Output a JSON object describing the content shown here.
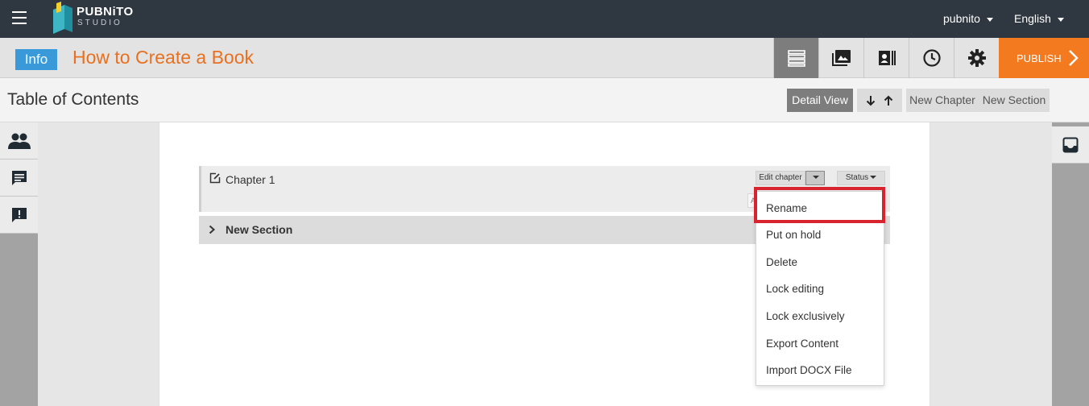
{
  "topbar": {
    "logo_name": "PUBNiTO",
    "logo_sub": "STUDIO",
    "user": "pubnito",
    "language": "English"
  },
  "titlebar": {
    "info": "Info",
    "book_title": "How to Create a Book",
    "publish": "PUBLISH"
  },
  "toolbar": {
    "page_title": "Table of Contents",
    "detail_view": "Detail View",
    "new_chapter": "New Chapter",
    "new_section": "New Section"
  },
  "chapter": {
    "name": "Chapter 1",
    "edit_label": "Edit chapter",
    "status_label": "Status",
    "peek_text": "A"
  },
  "section": {
    "name": "New Section"
  },
  "menu": {
    "items": [
      "Rename",
      "Put on hold",
      "Delete",
      "Lock editing",
      "Lock exclusively",
      "Export Content",
      "Import DOCX File"
    ]
  },
  "colors": {
    "topbar": "#2f3740",
    "accent_orange": "#f47a1f",
    "title_orange": "#e8701f",
    "info_blue": "#3a9ad9",
    "highlight_red": "#d7242e"
  }
}
